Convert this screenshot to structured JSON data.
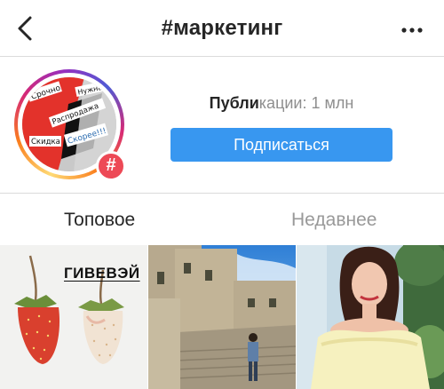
{
  "header": {
    "title": "#маркетинг",
    "back_icon": "chevron-left-icon",
    "more_icon": "more-horizontal-icon"
  },
  "profile": {
    "avatar_stickers": [
      "Срочно",
      "Нужна",
      "Распродажа",
      "Скидка",
      "Скорее!!!"
    ],
    "badge_symbol": "#",
    "posts_label_bold": "Публи",
    "posts_label_light": "кации: 1 млн",
    "follow_button": "Подписаться"
  },
  "tabs": [
    {
      "label": "Топовое",
      "active": true
    },
    {
      "label": "Недавнее",
      "active": false
    }
  ],
  "grid": {
    "post1_caption": "ГИВЕВЭЙ"
  },
  "colors": {
    "accent": "#3897f0",
    "badge": "#ed4956",
    "divider": "#dbdbdb",
    "muted": "#8e8e8e"
  }
}
